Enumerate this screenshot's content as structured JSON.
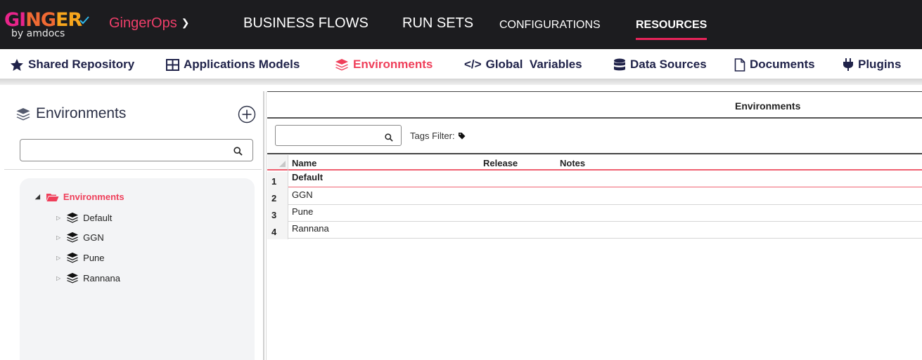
{
  "app": {
    "logo_text": "GINGER",
    "logo_byline": "by amdocs",
    "solution_name": "GingerOps"
  },
  "top_nav": [
    {
      "label": "BUSINESS FLOWS"
    },
    {
      "label": "RUN SETS"
    },
    {
      "label": "CONFIGURATIONS"
    },
    {
      "label": "RESOURCES",
      "active": true
    }
  ],
  "sub_nav": [
    {
      "label": "Shared Repository",
      "icon": "star-icon"
    },
    {
      "label": "Applications Models",
      "icon": "grid-icon"
    },
    {
      "label": "Environments",
      "icon": "layers-icon",
      "active": true
    },
    {
      "label": "Global  Variables",
      "icon": "code-icon"
    },
    {
      "label": "Data Sources",
      "icon": "database-icon"
    },
    {
      "label": "Documents",
      "icon": "document-icon"
    },
    {
      "label": "Plugins",
      "icon": "plug-icon"
    }
  ],
  "left_panel": {
    "title": "Environments",
    "search_value": "",
    "tree_root": "Environments",
    "tree_items": [
      "Default",
      "GGN",
      "Pune",
      "Rannana"
    ]
  },
  "right_panel": {
    "title": "Environments",
    "search_value": "",
    "tags_filter_label": "Tags Filter:",
    "columns": [
      "Name",
      "Release",
      "Notes"
    ],
    "rows": [
      {
        "num": "1",
        "name": "Default",
        "release": "",
        "notes": "",
        "selected": true
      },
      {
        "num": "2",
        "name": "GGN",
        "release": "",
        "notes": ""
      },
      {
        "num": "3",
        "name": "Pune",
        "release": "",
        "notes": ""
      },
      {
        "num": "4",
        "name": "Rannana",
        "release": "",
        "notes": ""
      }
    ]
  },
  "colors": {
    "topbar_bg": "#1c1c1f",
    "accent": "#ef3f5a",
    "nav_text": "#20234a"
  }
}
